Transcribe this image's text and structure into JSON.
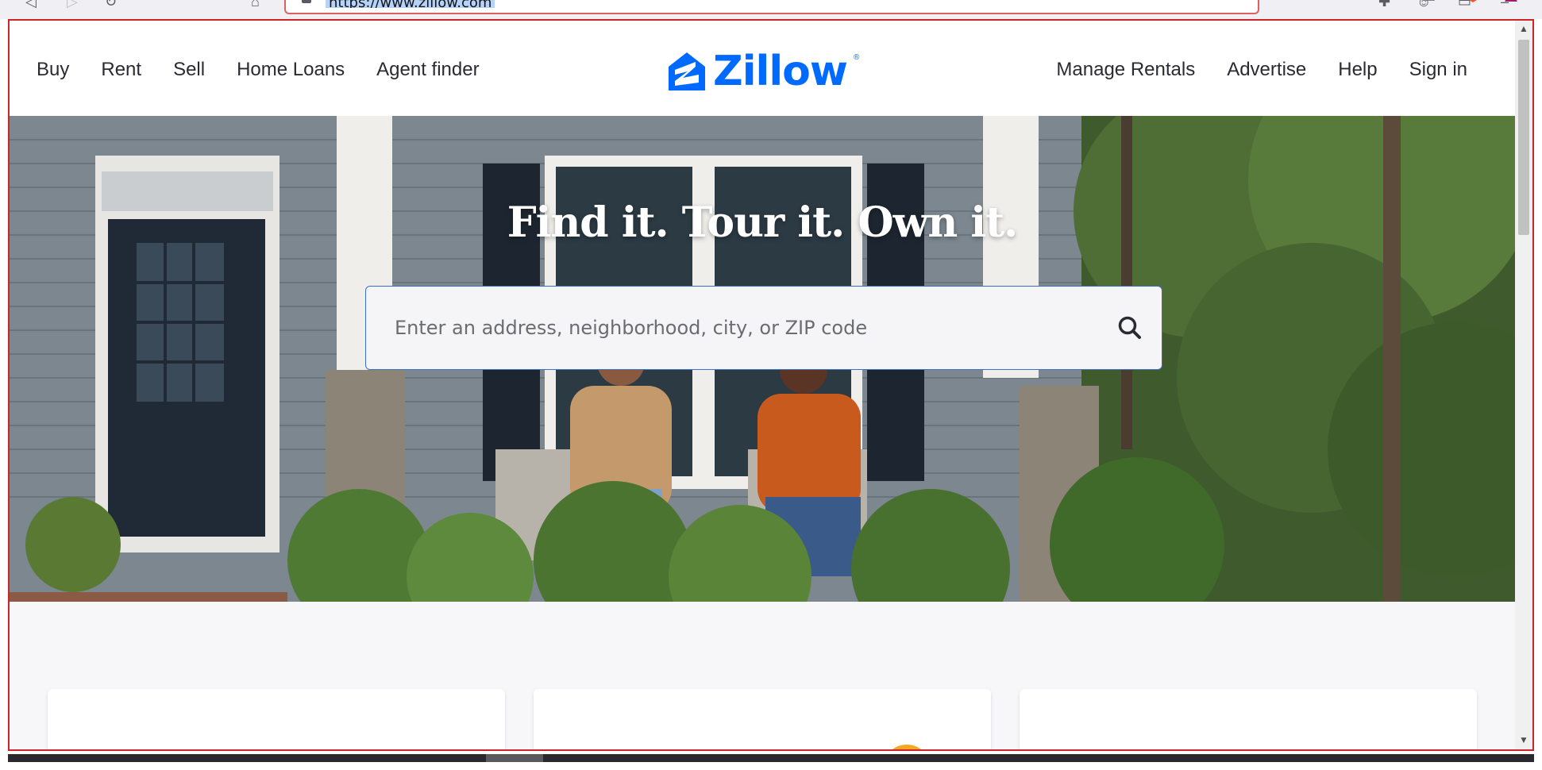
{
  "browser": {
    "url": "https://www.zillow.com"
  },
  "header": {
    "nav_left": [
      "Buy",
      "Rent",
      "Sell",
      "Home Loans",
      "Agent finder"
    ],
    "nav_right": [
      "Manage Rentals",
      "Advertise",
      "Help",
      "Sign in"
    ],
    "logo_text": "Zillow",
    "logo_reg": "®"
  },
  "hero": {
    "title": "Find it. Tour it. Own it.",
    "search_placeholder": "Enter an address, neighborhood, city, or ZIP code"
  },
  "colors": {
    "brand_blue": "#006aff",
    "frame_red": "#d0242b",
    "nav_text": "#2a2a33"
  },
  "icons": {
    "search": "search-icon",
    "logo": "zillow-logo-icon"
  }
}
